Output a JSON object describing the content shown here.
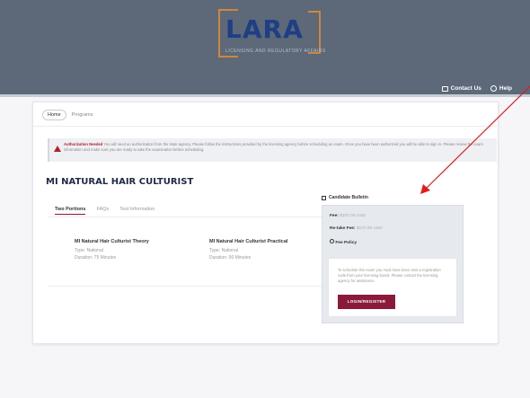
{
  "header": {
    "logo_text": "LARA",
    "logo_subtitle": "LICENSING AND REGULATORY AFFAIRS",
    "links": [
      {
        "label": "Contact Us",
        "icon": "mail-icon"
      },
      {
        "label": "Help",
        "icon": "question-icon"
      }
    ]
  },
  "breadcrumb": {
    "home": "Home",
    "current": "Programs"
  },
  "alert": {
    "title": "Authorization Needed",
    "text": "You will need an authorization from the state agency. Please follow the instructions provided by the licensing agency before scheduling an exam. Once you have been authorized you will be able to sign in. Please review the exam information and make sure you are ready to take the examination before scheduling."
  },
  "program": {
    "title": "MI NATURAL HAIR CULTURIST"
  },
  "tabs": [
    {
      "label": "Two Portions",
      "active": true
    },
    {
      "label": "FAQs",
      "active": false
    },
    {
      "label": "Test Information",
      "active": false
    }
  ],
  "exams": [
    {
      "name": "MI Natural Hair Culturist Theory",
      "type": "Type: National",
      "duration": "Duration: 75 Minutes"
    },
    {
      "name": "MI Natural Hair Culturist Practical",
      "type": "Type: National",
      "duration": "Duration: 90 Minutes"
    }
  ],
  "candidate": {
    "heading": "Candidate Bulletin",
    "fee_label": "Fee:",
    "fee_value": "$107.00 USD",
    "retake_label": "Re-take Fee:",
    "retake_value": "$107.00 USD",
    "policy_label": "Fee Policy",
    "note": "To schedule this exam you must have been sent a registration code from your licensing board. Please contact the licensing agency for assistance.",
    "button_label": "LOGIN/REGISTER"
  },
  "colors": {
    "header_bg": "#5d6878",
    "brand_blue": "#1e3f86",
    "logo_frame": "#c98a3a",
    "accent": "#8b1a3a",
    "annotation_arrow": "#e31b1b"
  }
}
